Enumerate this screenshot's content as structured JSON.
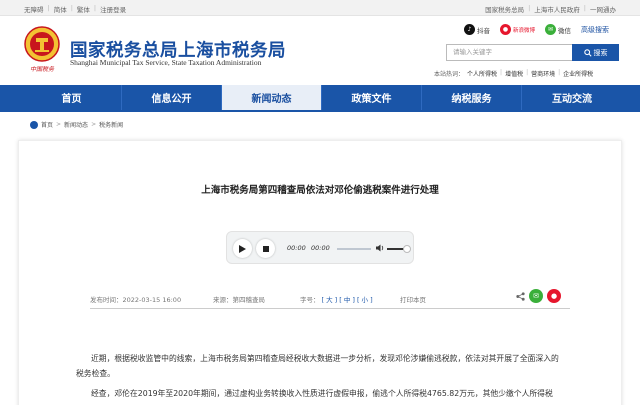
{
  "topbar": {
    "left": [
      "无障碍",
      "简体",
      "繁体",
      "注册登录"
    ],
    "right": [
      "国家税务总局",
      "上海市人民政府",
      "一网通办"
    ]
  },
  "header": {
    "emblem_caption": "中国税务",
    "title": "国家税务总局上海市税务局",
    "subtitle": "Shanghai Municipal Tax Service, State Taxation Administration",
    "social": {
      "douyin": "抖音",
      "weibo": "新浪微博",
      "wechat": "微信",
      "advanced_search": "高级搜索"
    },
    "search": {
      "placeholder": "请输入关键字",
      "button": "搜索"
    },
    "hotwords": {
      "label": "本站热词：",
      "items": [
        "个人所得税",
        "增值税",
        "营商环境",
        "企业所得税"
      ]
    }
  },
  "nav": {
    "items": [
      "首页",
      "信息公开",
      "新闻动态",
      "政策文件",
      "纳税服务",
      "互动交流"
    ],
    "active_index": 2
  },
  "breadcrumb": {
    "items": [
      "首页",
      "新闻动态",
      "税务新闻"
    ]
  },
  "article": {
    "title": "上海市税务局第四稽查局依法对邓伦偷逃税案件进行处理",
    "player": {
      "current": "00:00",
      "duration": "00:00"
    },
    "meta": {
      "published": "发布时间：2022-03-15 16:00",
      "source": "来源：第四稽查局",
      "font_label": "字号：",
      "font_sizes": [
        "[ 大 ]",
        "[ 中 ]",
        "[ 小 ]"
      ],
      "print": "打印本页"
    },
    "paragraphs": [
      "近期，根据税收监管中的线索，上海市税务局第四稽查局经税收大数据进一步分析，发现邓伦涉嫌偷逃税款，依法对其开展了全面深入的税务检查。",
      "经查，邓伦在2019年至2020年期间，通过虚构业务转换收入性质进行虚假申报，偷逃个人所得税4765.82万元，其他少缴个人所得税"
    ]
  },
  "colors": {
    "brand_blue": "#1a55a8",
    "title_blue": "#1a4fa0",
    "wechat_green": "#3aaf3a",
    "weibo_red": "#e6162d"
  }
}
